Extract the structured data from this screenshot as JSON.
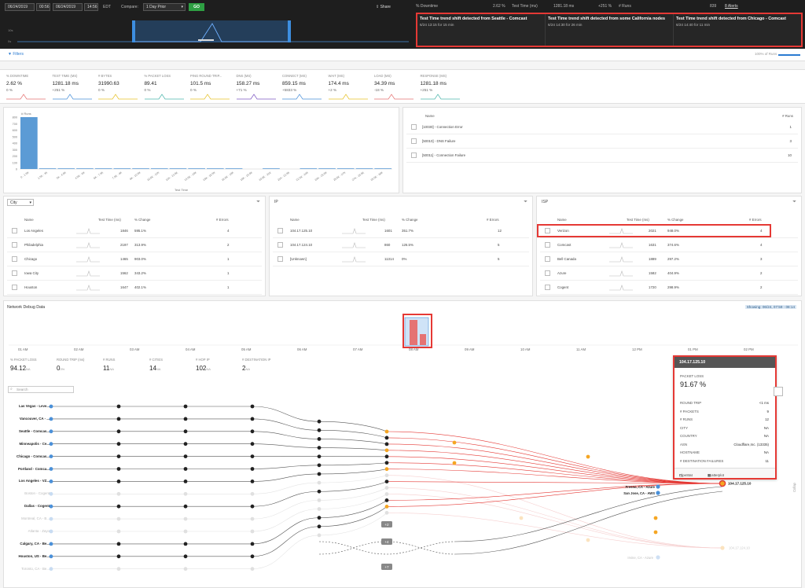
{
  "topbar": {
    "date_start": "06/24/2019",
    "time_start": "00:56",
    "date_end": "06/24/2019",
    "time_end": "14:56",
    "timezone": "EDT",
    "compare_label": "Compare:",
    "compare_value": "1 Day Prior",
    "go_label": "GO",
    "share_label": "Share",
    "summary": {
      "downtime_label": "% Downtime",
      "downtime_value": "2.62 %",
      "testtime_label": "Test Time (ms)",
      "testtime_value": "1281.18 ms",
      "testtime_change": "+251 %",
      "runs_label": "# Runs",
      "runs_value": "839",
      "alerts_label": "8 Alerts"
    }
  },
  "alerts": [
    {
      "title": "Test Time trend shift detected from Seattle - Comcast",
      "sub": "6/24 13:15 for 15 min"
    },
    {
      "title": "Test Time trend shift detected from some California nodes",
      "sub": "6/24 14:30 for 26 min"
    },
    {
      "title": "Test Time trend shift detected from Chicago - Comcast",
      "sub": "6/24 14:40 for 11 min"
    }
  ],
  "filters": {
    "label": "Filters",
    "runs_pct": "100% of Runs"
  },
  "metrics": [
    {
      "label": "% DOWNTIME",
      "value": "2.62 %",
      "change": "0 %",
      "color": "#e57373"
    },
    {
      "label": "TEST TIME (MS)",
      "value": "1281.18 ms",
      "change": "+251 %",
      "color": "#4a90d9"
    },
    {
      "label": "# BYTES",
      "value": "31990.63",
      "change": "0 %",
      "color": "#e6c229"
    },
    {
      "label": "% PACKET LOSS",
      "value": "89.41",
      "change": "0 %",
      "color": "#4db6ac"
    },
    {
      "label": "PING ROUND TRIP...",
      "value": "101.5 ms",
      "change": "0 %",
      "color": "#e6c229"
    },
    {
      "label": "DNS (MS)",
      "value": "158.27 ms",
      "change": "+71 %",
      "color": "#7e57c2"
    },
    {
      "label": "CONNECT (MS)",
      "value": "859.15 ms",
      "change": "+5833 %",
      "color": "#4a90d9"
    },
    {
      "label": "WAIT (MS)",
      "value": "174.4 ms",
      "change": "+2 %",
      "color": "#e6c229"
    },
    {
      "label": "LOAD (MS)",
      "value": "34.39 ms",
      "change": "-18 %",
      "color": "#e57373"
    },
    {
      "label": "RESPONSE (MS)",
      "value": "1281.18 ms",
      "change": "+251 %",
      "color": "#4db6ac"
    }
  ],
  "histogram": {
    "ylabel": "# Runs",
    "xlabel": "Test Time",
    "yticks": [
      "800",
      "700",
      "600",
      "500",
      "400",
      "300",
      "200",
      "100",
      "0"
    ],
    "xticks": [
      "0 - 1.5K",
      "1.5K - 3K",
      "3K - 4.5K",
      "4.5K - 6K",
      "6K - 7.5K",
      "7.5K - 9K",
      "9K - 10.5K",
      "10.5K - 12K",
      "12K - 13.5K",
      "13.5K - 15K",
      "15K - 16.5K",
      "16.5K - 18K",
      "18K - 19.5K",
      "19.5K - 21K",
      "21K - 22.5K",
      "22.5K - 24K",
      "24K - 25.5K",
      "25.5K - 27K",
      "27K - 28.5K",
      "28.5K - 30K"
    ],
    "values": [
      800,
      8,
      2,
      3,
      6,
      3,
      1,
      2,
      3,
      2,
      1,
      1,
      0,
      2,
      0,
      1,
      5,
      6,
      3,
      4
    ],
    "ymax": 800
  },
  "errors": {
    "col_name": "Name",
    "col_runs": "# Runs",
    "rows": [
      {
        "name": "[10030] - Connection Error",
        "runs": "1"
      },
      {
        "name": "[50010] - DNS Failure",
        "runs": "3"
      },
      {
        "name": "[50011] - Connection Failure",
        "runs": "10"
      }
    ]
  },
  "city_table": {
    "dropdown": "City",
    "cols": {
      "name": "Name",
      "time": "Test Time (ms)",
      "change": "% Change",
      "errors": "# Errors"
    },
    "rows": [
      {
        "name": "Los Angeles",
        "time": "1846",
        "change": "595.1%",
        "errors": "4"
      },
      {
        "name": "Philadelphia",
        "time": "2197",
        "change": "313.9%",
        "errors": "2"
      },
      {
        "name": "Chicago",
        "time": "1465",
        "change": "903.0%",
        "errors": "1"
      },
      {
        "name": "Iowa City",
        "time": "1562",
        "change": "343.2%",
        "errors": "1"
      },
      {
        "name": "Houston",
        "time": "1647",
        "change": "402.1%",
        "errors": "1"
      }
    ]
  },
  "ip_table": {
    "title": "IP",
    "cols": {
      "name": "Name",
      "time": "Test Time (ms)",
      "change": "% Change",
      "errors": "# Errors"
    },
    "rows": [
      {
        "name": "104.17.125.10",
        "time": "1601",
        "change": "351.7%",
        "errors": "12"
      },
      {
        "name": "104.17.124.10",
        "time": "860",
        "change": "126.5%",
        "errors": "5"
      },
      {
        "name": "[Unknown]",
        "time": "11314",
        "change": "0%",
        "errors": "5"
      }
    ]
  },
  "isp_table": {
    "title": "ISP",
    "cols": {
      "name": "Name",
      "time": "Test Time (ms)",
      "change": "% Change",
      "errors": "# Errors"
    },
    "rows": [
      {
        "name": "Verizon",
        "time": "2021",
        "change": "948.0%",
        "errors": "4"
      },
      {
        "name": "Comcast",
        "time": "1631",
        "change": "374.6%",
        "errors": "4"
      },
      {
        "name": "Bell Canada",
        "time": "1889",
        "change": "297.2%",
        "errors": "3"
      },
      {
        "name": "Azure",
        "time": "1582",
        "change": "404.9%",
        "errors": "2"
      },
      {
        "name": "Cogent",
        "time": "1720",
        "change": "298.9%",
        "errors": "2"
      }
    ]
  },
  "debug": {
    "title": "Network Debug Data",
    "showing": "Showing: 06/24, 07:59 - 08:14",
    "ticks": [
      "01 AM",
      "02 AM",
      "03 AM",
      "04 AM",
      "05 AM",
      "06 AM",
      "07 AM",
      "08 AM",
      "09 AM",
      "10 AM",
      "11 AM",
      "12 PM",
      "01 PM",
      "02 PM"
    ],
    "stats": [
      {
        "label": "% PACKET LOSS",
        "value": "94.12",
        "unit": "NA"
      },
      {
        "label": "ROUND TRIP (ms)",
        "value": "0",
        "unit": "0%"
      },
      {
        "label": "# RUNS",
        "value": "11",
        "unit": "NA"
      },
      {
        "label": "# CITIES",
        "value": "14",
        "unit": "NA"
      },
      {
        "label": "# HOP IP",
        "value": "102",
        "unit": "NA"
      },
      {
        "label": "# DESTINATION IP",
        "value": "2",
        "unit": "NA"
      }
    ],
    "search_placeholder": "Search",
    "sources": [
      {
        "name": "Las Vegas - Leve...",
        "faded": false
      },
      {
        "name": "Vancouver, CA - ...",
        "faded": false
      },
      {
        "name": "Seattle - Comcas...",
        "faded": false
      },
      {
        "name": "Minneapolis - Ce...",
        "faded": false
      },
      {
        "name": "Chicago - Comcas...",
        "faded": false
      },
      {
        "name": "Portland - Comca...",
        "faded": false
      },
      {
        "name": "Los Angeles - VZ...",
        "faded": false
      },
      {
        "name": "Boston - Cogent",
        "faded": true
      },
      {
        "name": "Dallas - Cogent",
        "faded": false
      },
      {
        "name": "Montreal, CA - B...",
        "faded": true
      },
      {
        "name": "Atlanta - Zayo",
        "faded": true
      },
      {
        "name": "Calgary, CA - Be...",
        "faded": false
      },
      {
        "name": "Houston, US - Be...",
        "faded": false
      },
      {
        "name": "Toronto, CA - Be...",
        "faded": true
      }
    ],
    "badges": [
      "+2",
      "+4",
      "+7"
    ],
    "dest_main": "104.17.125.10",
    "dest_secondary": "104.17.124.10",
    "hop_label_1": "Fresno, CA - Azure",
    "hop_label_2": "San Jose, CA - AWS",
    "hop_label_3": "Irvine, CA - Azure",
    "side_label": "Collap"
  },
  "tooltip": {
    "title": "104.17.125.10",
    "packet_loss_label": "PACKET LOSS",
    "packet_loss_value": "91.67 %",
    "rows": [
      {
        "label": "ROUND TRIP",
        "value": "<1 ms"
      },
      {
        "label": "# PACKETS",
        "value": "9"
      },
      {
        "label": "# RUNS",
        "value": "12"
      },
      {
        "label": "CITY",
        "value": "NA"
      },
      {
        "label": "COUNTRY",
        "value": "NA"
      },
      {
        "label": "ASN",
        "value": "Cloudflare,Inc. (13335)"
      },
      {
        "label": "HOSTNAME",
        "value": "NA"
      },
      {
        "label": "# DESTINATION FAILURES",
        "value": "11"
      }
    ],
    "ripestat_label": "RipeStat",
    "scatterplot_label": "Scatterplot"
  }
}
